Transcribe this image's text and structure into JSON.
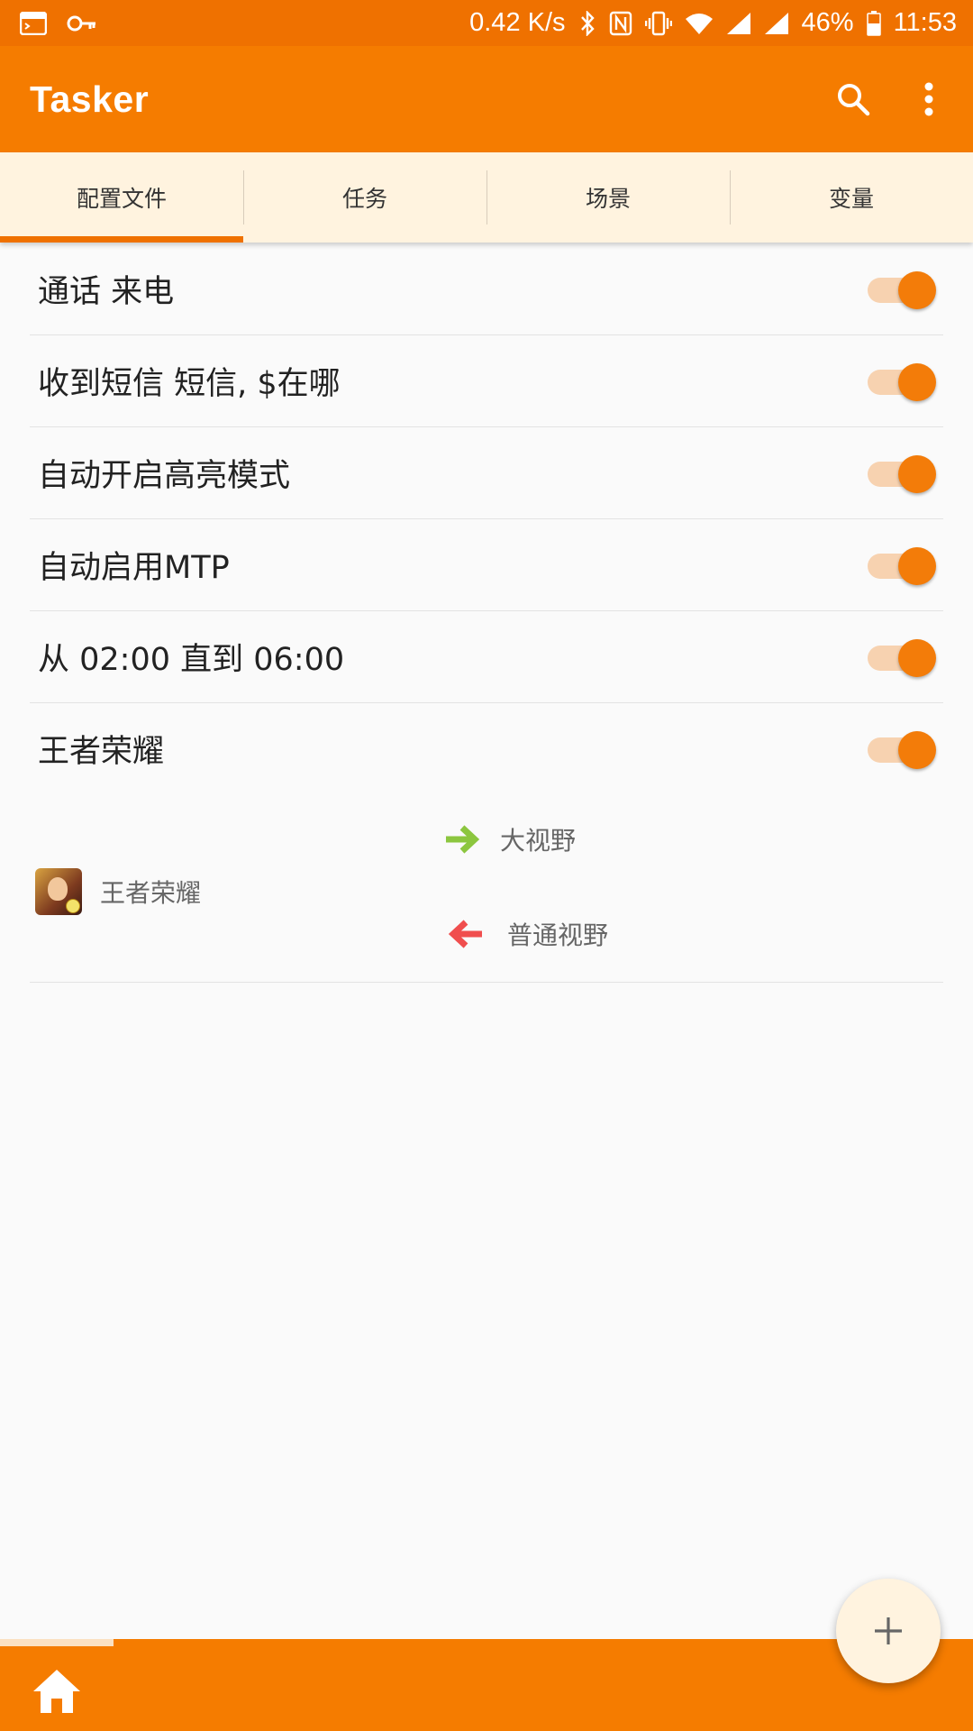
{
  "status_bar": {
    "net_speed": "0.42 K/s",
    "battery": "46%",
    "time": "11:53"
  },
  "app_bar": {
    "title": "Tasker",
    "search_icon": "search-icon",
    "more_icon": "more-vert-icon"
  },
  "tabs": [
    {
      "label": "配置文件",
      "active": true
    },
    {
      "label": "任务",
      "active": false
    },
    {
      "label": "场景",
      "active": false
    },
    {
      "label": "变量",
      "active": false
    }
  ],
  "profiles": [
    {
      "label": "通话 来电",
      "enabled": true
    },
    {
      "label": "收到短信 短信, $在哪",
      "enabled": true
    },
    {
      "label": "自动开启高亮模式",
      "enabled": true
    },
    {
      "label": "自动启用MTP",
      "enabled": true
    },
    {
      "label": "从 02:00 直到 06:00",
      "enabled": true
    },
    {
      "label": "王者荣耀",
      "enabled": true
    }
  ],
  "expanded_profile": {
    "context_label": "王者荣耀",
    "enter_task": "大视野",
    "exit_task": "普通视野",
    "enter_arrow_color": "#8cc63f",
    "exit_arrow_color": "#f04e4e"
  },
  "colors": {
    "primary": "#f57c00",
    "status_bar": "#ef7100",
    "tab_background": "#fff3df"
  },
  "bottom": {
    "home_icon": "home-icon",
    "fab_icon": "plus-icon"
  }
}
